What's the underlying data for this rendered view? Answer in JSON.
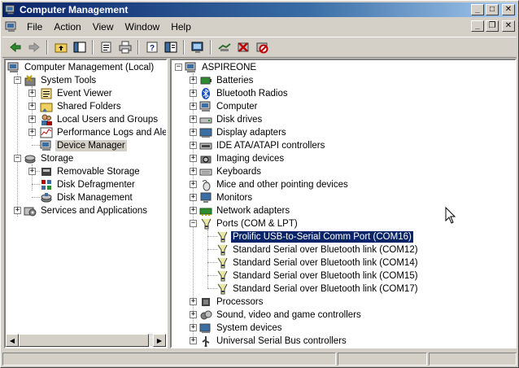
{
  "window": {
    "title": "Computer Management"
  },
  "menubar": {
    "items": [
      "File",
      "Action",
      "View",
      "Window",
      "Help"
    ]
  },
  "toolbar": {
    "icons": [
      "back-arrow-icon",
      "forward-arrow-icon",
      "up-folder-icon",
      "show-hide-tree-icon",
      "properties-icon",
      "print-icon",
      "help-icon",
      "help-topics-icon",
      "scan-hardware-icon",
      "update-driver-icon",
      "uninstall-icon",
      "disable-icon"
    ]
  },
  "left_tree": [
    {
      "label": "Computer Management (Local)",
      "icon": "computer-management-icon"
    },
    {
      "label": "System Tools",
      "icon": "system-tools-icon"
    },
    {
      "label": "Event Viewer",
      "icon": "event-viewer-icon"
    },
    {
      "label": "Shared Folders",
      "icon": "shared-folders-icon"
    },
    {
      "label": "Local Users and Groups",
      "icon": "users-icon"
    },
    {
      "label": "Performance Logs and Alerts",
      "icon": "performance-icon"
    },
    {
      "label": "Device Manager",
      "icon": "device-manager-icon"
    },
    {
      "label": "Storage",
      "icon": "storage-icon"
    },
    {
      "label": "Removable Storage",
      "icon": "removable-storage-icon"
    },
    {
      "label": "Disk Defragmenter",
      "icon": "defrag-icon"
    },
    {
      "label": "Disk Management",
      "icon": "disk-management-icon"
    },
    {
      "label": "Services and Applications",
      "icon": "services-icon"
    }
  ],
  "right_tree": {
    "root": "ASPIREONE",
    "categories": [
      {
        "label": "Batteries",
        "icon": "battery-icon"
      },
      {
        "label": "Bluetooth Radios",
        "icon": "bluetooth-icon"
      },
      {
        "label": "Computer",
        "icon": "computer-icon"
      },
      {
        "label": "Disk drives",
        "icon": "disk-drive-icon"
      },
      {
        "label": "Display adapters",
        "icon": "display-adapter-icon"
      },
      {
        "label": "IDE ATA/ATAPI controllers",
        "icon": "ide-controller-icon"
      },
      {
        "label": "Imaging devices",
        "icon": "imaging-icon"
      },
      {
        "label": "Keyboards",
        "icon": "keyboard-icon"
      },
      {
        "label": "Mice and other pointing devices",
        "icon": "mouse-icon"
      },
      {
        "label": "Monitors",
        "icon": "monitor-icon"
      },
      {
        "label": "Network adapters",
        "icon": "network-adapter-icon"
      },
      {
        "label": "Ports (COM & LPT)",
        "icon": "port-icon"
      }
    ],
    "ports": [
      "Prolific USB-to-Serial Comm Port (COM16)",
      "Standard Serial over Bluetooth link (COM12)",
      "Standard Serial over Bluetooth link (COM14)",
      "Standard Serial over Bluetooth link (COM15)",
      "Standard Serial over Bluetooth link (COM17)"
    ],
    "after": [
      {
        "label": "Processors",
        "icon": "processor-icon"
      },
      {
        "label": "Sound, video and game controllers",
        "icon": "sound-icon"
      },
      {
        "label": "System devices",
        "icon": "system-device-icon"
      },
      {
        "label": "Universal Serial Bus controllers",
        "icon": "usb-icon"
      }
    ]
  },
  "colors": {
    "title_start": "#0a246a",
    "title_end": "#a6caf0",
    "selection": "#0a246a",
    "face": "#d4d0c8"
  }
}
